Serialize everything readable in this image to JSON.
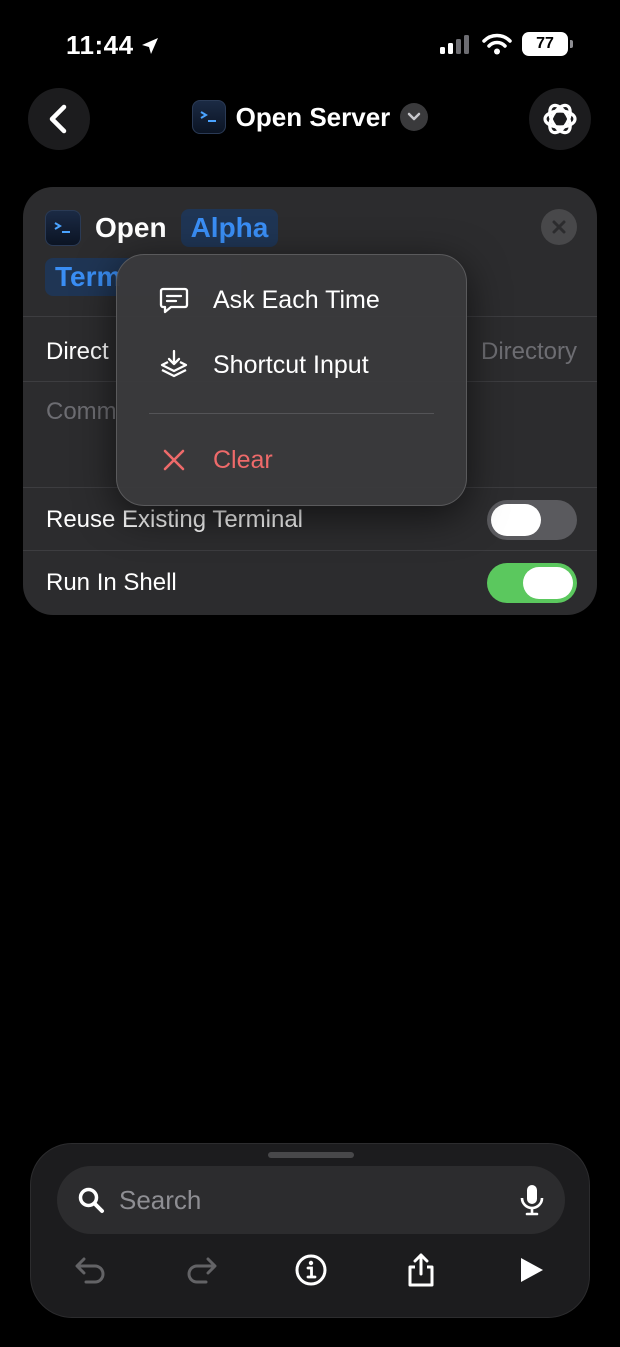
{
  "status_bar": {
    "time": "11:44",
    "battery": "77"
  },
  "nav": {
    "title": "Open Server"
  },
  "action": {
    "verb": "Open",
    "app_token": "Alpha",
    "app_token_line2": "Term",
    "directory_label": "Direct",
    "directory_value": "Directory",
    "command_placeholder": "Comm",
    "reuse_label": "Reuse Existing Terminal",
    "reuse_on": false,
    "shell_label": "Run In Shell",
    "shell_on": true
  },
  "menu": {
    "items": [
      {
        "label": "Ask Each Time",
        "icon": "speech-bubble-icon"
      },
      {
        "label": "Shortcut Input",
        "icon": "shortcut-input-icon"
      }
    ],
    "clear_label": "Clear"
  },
  "bottom": {
    "search_placeholder": "Search"
  },
  "colors": {
    "accent_blue": "#3a8ef5",
    "toggle_on": "#5bc85e",
    "danger": "#ee6a6a"
  }
}
